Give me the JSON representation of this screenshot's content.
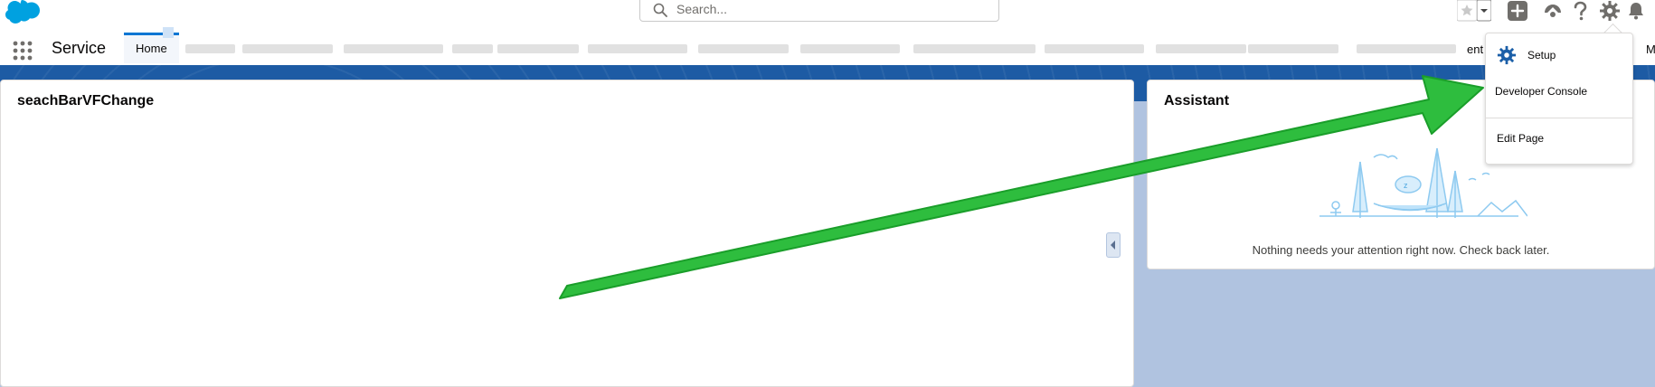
{
  "header": {
    "search": {
      "placeholder": "Search..."
    },
    "icons": [
      "salesforce-cloud-logo",
      "favorites-star-icon",
      "favorites-dropdown-icon",
      "global-actions-plus-icon",
      "trailhead-icon",
      "help-icon",
      "setup-gear-icon",
      "notifications-bell-icon"
    ]
  },
  "nav": {
    "app_name": "Service",
    "active_tab": "Home",
    "partial_tab_1": "ent",
    "partial_tab_2": "M"
  },
  "left_card": {
    "title": "seachBarVFChange"
  },
  "assistant": {
    "title": "Assistant",
    "empty_message": "Nothing needs your attention right now. Check back later."
  },
  "setup_menu": {
    "items": [
      {
        "label": "Setup"
      },
      {
        "label": "Developer Console"
      },
      {
        "label": "Edit Page"
      }
    ]
  },
  "colors": {
    "brand_blue": "#0176d3",
    "header_band": "#1d5ba4",
    "page_background": "#b0c3e0",
    "annotation_arrow": "#2ebd3e"
  }
}
